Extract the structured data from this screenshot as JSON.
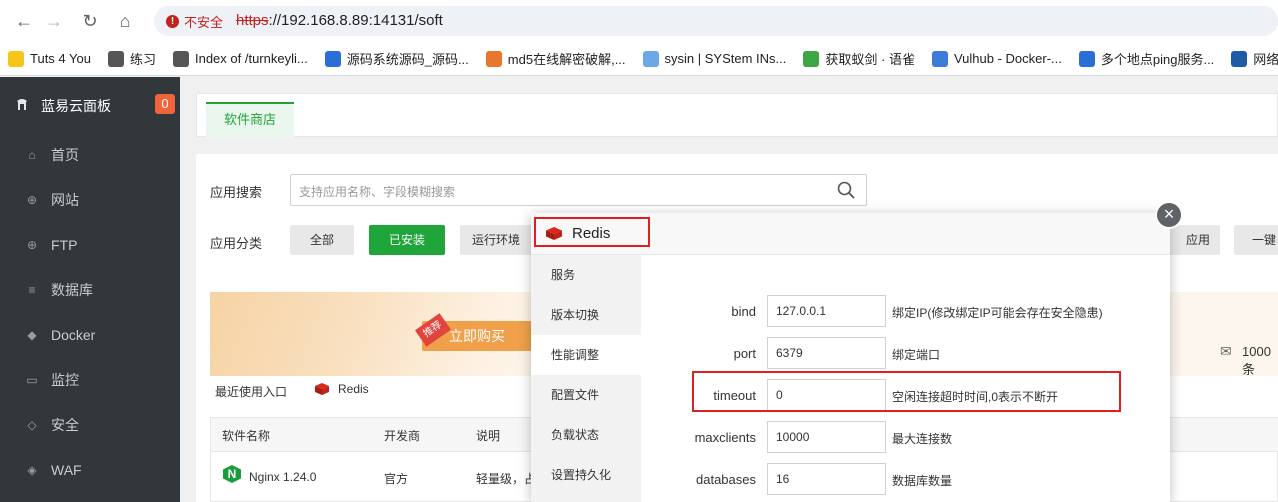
{
  "browser": {
    "insecure_label": "不安全",
    "url_scheme": "https",
    "url_rest": "://192.168.8.89:14131/soft",
    "bookmarks": [
      {
        "label": "Tuts 4 You",
        "color": "#f5c518"
      },
      {
        "label": "练习",
        "color": "#555555"
      },
      {
        "label": "Index of /turnkeyli...",
        "color": "#555555"
      },
      {
        "label": "源码系统源码_源码...",
        "color": "#2b6fd6"
      },
      {
        "label": "md5在线解密破解,...",
        "color": "#e8772e"
      },
      {
        "label": "sysin | SYStem INs...",
        "color": "#6aa8e8"
      },
      {
        "label": "获取蚁剑 · 语雀",
        "color": "#3aa845"
      },
      {
        "label": "Vulhub - Docker-...",
        "color": "#3b7dd8"
      },
      {
        "label": "多个地点ping服务...",
        "color": "#2b6fd6"
      },
      {
        "label": "网络空间",
        "color": "#1f5aa6"
      }
    ]
  },
  "sidebar": {
    "brand": "蓝易云面板",
    "badge": "0",
    "items": [
      {
        "label": "首页",
        "icon": "home-icon"
      },
      {
        "label": "网站",
        "icon": "globe-icon"
      },
      {
        "label": "FTP",
        "icon": "ftp-icon"
      },
      {
        "label": "数据库",
        "icon": "database-icon"
      },
      {
        "label": "Docker",
        "icon": "docker-icon"
      },
      {
        "label": "监控",
        "icon": "monitor-icon"
      },
      {
        "label": "安全",
        "icon": "shield-icon"
      },
      {
        "label": "WAF",
        "icon": "waf-icon"
      }
    ]
  },
  "main": {
    "tab": "软件商店",
    "search_label": "应用搜索",
    "search_placeholder": "支持应用名称、字段模糊搜索",
    "category_label": "应用分类",
    "categories": [
      "全部",
      "已安装",
      "运行环境"
    ],
    "categories_right": [
      "应用",
      "一键"
    ],
    "banner_tag": "推荐",
    "banner_button": "立即购买",
    "banner_right_text": "1000条",
    "banner_right_partial": "\u0000",
    "recent_label": "最近使用入口",
    "recent_item": "Redis",
    "table_headers": [
      "软件名称",
      "开发商",
      "说明"
    ],
    "rows": [
      {
        "name": "Nginx 1.24.0",
        "vendor": "官方",
        "desc": "轻量级，占"
      }
    ]
  },
  "modal": {
    "title": "Redis",
    "nav": [
      "服务",
      "版本切换",
      "性能调整",
      "配置文件",
      "负载状态",
      "设置持久化"
    ],
    "active_nav": "性能调整",
    "fields": [
      {
        "label": "bind",
        "value": "127.0.0.1",
        "help": "绑定IP(修改绑定IP可能会存在安全隐患)"
      },
      {
        "label": "port",
        "value": "6379",
        "help": "绑定端口"
      },
      {
        "label": "timeout",
        "value": "0",
        "help": "空闲连接超时时间,0表示不断开"
      },
      {
        "label": "maxclients",
        "value": "10000",
        "help": "最大连接数"
      },
      {
        "label": "databases",
        "value": "16",
        "help": "数据库数量"
      }
    ]
  },
  "colors": {
    "accent": "#20a53a",
    "highlight": "#e02020",
    "sidebar_bg": "#32373c"
  }
}
